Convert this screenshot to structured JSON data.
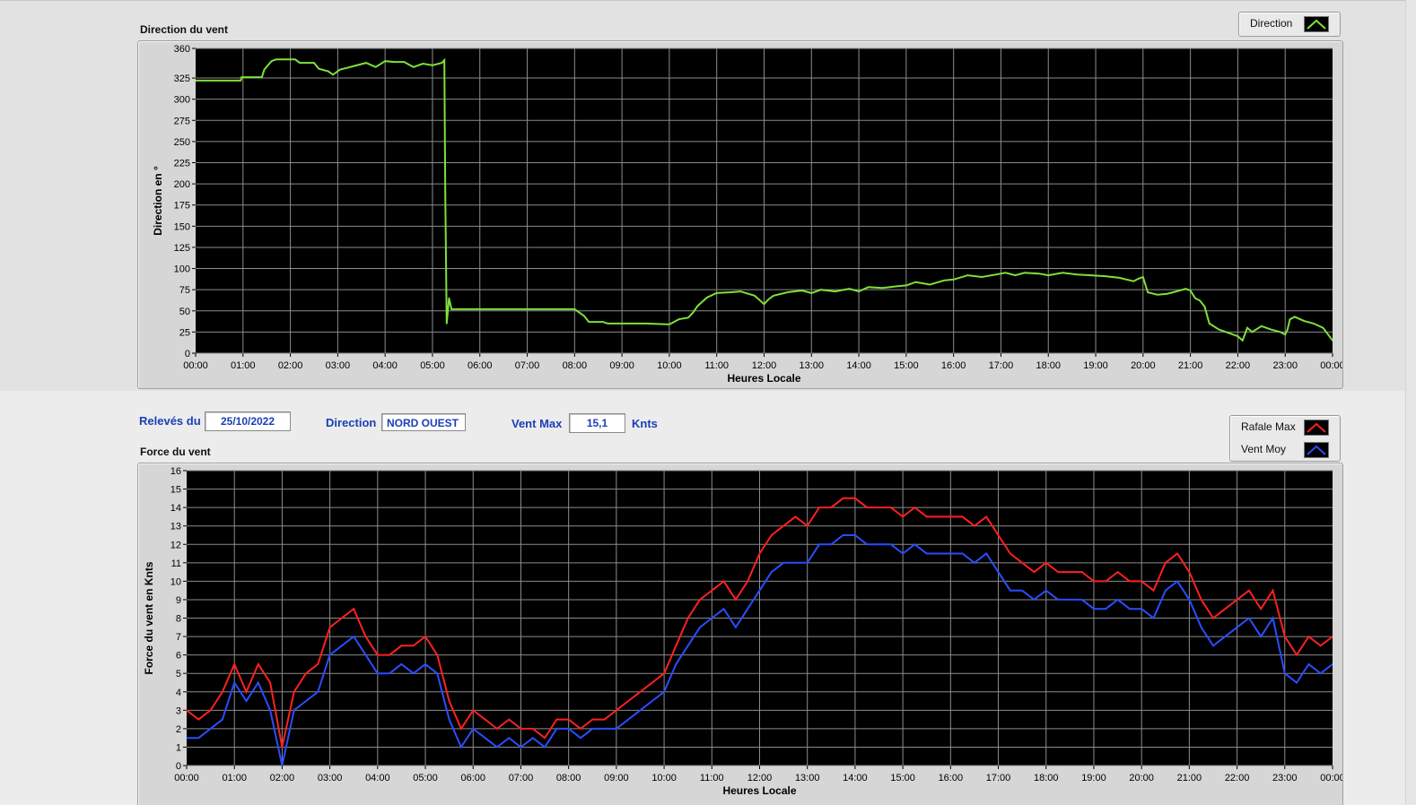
{
  "direction_section": {
    "title": "Direction du vent",
    "legend": {
      "label": "Direction",
      "color": "#7fe03a"
    }
  },
  "info_bar": {
    "date_label": "Relevés du",
    "date_value": "25/10/2022",
    "direction_label": "Direction",
    "direction_value": "NORD OUEST",
    "vent_max_label": "Vent Max",
    "vent_max_value": "15,1",
    "vent_max_unit": "Knts"
  },
  "force_section": {
    "title": "Force du vent",
    "legend": [
      {
        "label": "Rafale Max",
        "color": "#ff2020"
      },
      {
        "label": "Vent Moy",
        "color": "#2a4dff"
      }
    ]
  },
  "chart_data": [
    {
      "type": "line",
      "ylabel": "Direction en °",
      "xlabel": "Heures Locale",
      "ylim": [
        0,
        360
      ],
      "xlim": [
        0,
        24
      ],
      "yticks": [
        0,
        25,
        50,
        75,
        100,
        125,
        150,
        175,
        200,
        225,
        250,
        275,
        300,
        325,
        360
      ],
      "xtick_labels": [
        "00:00",
        "01:00",
        "02:00",
        "03:00",
        "04:00",
        "05:00",
        "06:00",
        "07:00",
        "08:00",
        "09:00",
        "10:00",
        "11:00",
        "12:00",
        "13:00",
        "14:00",
        "15:00",
        "16:00",
        "17:00",
        "18:00",
        "19:00",
        "20:00",
        "21:00",
        "22:00",
        "23:00",
        "00:00"
      ],
      "grid": true,
      "background": "#000000",
      "series": [
        {
          "name": "Direction",
          "color": "#7fe03a",
          "x": [
            0,
            0.95,
            0.97,
            1.4,
            1.45,
            1.6,
            1.7,
            2.1,
            2.2,
            2.5,
            2.6,
            2.8,
            2.9,
            3.05,
            3.2,
            3.4,
            3.6,
            3.8,
            4.0,
            4.2,
            4.4,
            4.6,
            4.8,
            5.0,
            5.2,
            5.25,
            5.27,
            5.3,
            5.35,
            5.4,
            5.6,
            6.0,
            7.0,
            8.0,
            8.2,
            8.3,
            8.6,
            8.7,
            9.0,
            9.5,
            10.0,
            10.2,
            10.4,
            10.5,
            10.6,
            10.8,
            11.0,
            11.3,
            11.5,
            11.8,
            12.0,
            12.1,
            12.2,
            12.5,
            12.8,
            13.0,
            13.2,
            13.5,
            13.8,
            14.0,
            14.2,
            14.5,
            14.8,
            15.0,
            15.2,
            15.5,
            15.8,
            16.0,
            16.3,
            16.6,
            16.9,
            17.1,
            17.3,
            17.5,
            17.8,
            18.0,
            18.3,
            18.6,
            18.9,
            19.2,
            19.5,
            19.8,
            19.9,
            20.0,
            20.1,
            20.3,
            20.5,
            20.7,
            20.9,
            21.0,
            21.1,
            21.2,
            21.3,
            21.4,
            21.6,
            21.8,
            22.0,
            22.1,
            22.2,
            22.3,
            22.5,
            22.7,
            22.9,
            23.0,
            23.05,
            23.1,
            23.2,
            23.4,
            23.6,
            23.8,
            24.0
          ],
          "y": [
            322,
            322,
            326,
            326,
            335,
            345,
            347,
            347,
            343,
            343,
            336,
            333,
            329,
            335,
            337,
            340,
            343,
            338,
            345,
            344,
            344,
            338,
            342,
            340,
            343,
            346,
            190,
            35,
            65,
            52,
            52,
            52,
            52,
            52,
            44,
            37,
            37,
            35,
            35,
            35,
            34,
            40,
            42,
            48,
            56,
            66,
            71,
            72,
            73,
            68,
            58,
            64,
            68,
            72,
            74,
            71,
            75,
            73,
            76,
            73,
            78,
            77,
            79,
            80,
            84,
            81,
            86,
            87,
            92,
            90,
            93,
            95,
            92,
            95,
            94,
            92,
            95,
            93,
            92,
            91,
            89,
            85,
            88,
            90,
            72,
            69,
            70,
            73,
            76,
            74,
            65,
            62,
            55,
            35,
            28,
            24,
            20,
            15,
            30,
            25,
            32,
            28,
            25,
            22,
            28,
            40,
            43,
            38,
            35,
            30,
            15
          ]
        }
      ]
    },
    {
      "type": "line",
      "ylabel": "Force du vent en Knts",
      "xlabel": "Heures Locale",
      "ylim": [
        0,
        16
      ],
      "xlim": [
        0,
        24
      ],
      "yticks": [
        0,
        1,
        2,
        3,
        4,
        5,
        6,
        7,
        8,
        9,
        10,
        11,
        12,
        13,
        14,
        15,
        16
      ],
      "xtick_labels": [
        "00:00",
        "01:00",
        "02:00",
        "03:00",
        "04:00",
        "05:00",
        "06:00",
        "07:00",
        "08:00",
        "09:00",
        "10:00",
        "11:00",
        "12:00",
        "13:00",
        "14:00",
        "15:00",
        "16:00",
        "17:00",
        "18:00",
        "19:00",
        "20:00",
        "21:00",
        "22:00",
        "23:00",
        "00:00"
      ],
      "grid": true,
      "background": "#000000",
      "series": [
        {
          "name": "Rafale Max",
          "color": "#ff2020",
          "x": [
            0,
            0.25,
            0.5,
            0.75,
            1.0,
            1.25,
            1.5,
            1.75,
            2.0,
            2.25,
            2.5,
            2.75,
            3.0,
            3.25,
            3.5,
            3.75,
            4.0,
            4.25,
            4.5,
            4.75,
            5.0,
            5.25,
            5.5,
            5.75,
            6.0,
            6.25,
            6.5,
            6.75,
            7.0,
            7.25,
            7.5,
            7.75,
            8.0,
            8.25,
            8.5,
            8.75,
            9.0,
            9.25,
            9.5,
            9.75,
            10.0,
            10.25,
            10.5,
            10.75,
            11.0,
            11.25,
            11.5,
            11.75,
            12.0,
            12.25,
            12.5,
            12.75,
            13.0,
            13.25,
            13.5,
            13.75,
            14.0,
            14.25,
            14.5,
            14.75,
            15.0,
            15.25,
            15.5,
            15.75,
            16.0,
            16.25,
            16.5,
            16.75,
            17.0,
            17.25,
            17.5,
            17.75,
            18.0,
            18.25,
            18.5,
            18.75,
            19.0,
            19.25,
            19.5,
            19.75,
            20.0,
            20.25,
            20.5,
            20.75,
            21.0,
            21.25,
            21.5,
            21.75,
            22.0,
            22.25,
            22.5,
            22.75,
            23.0,
            23.25,
            23.5,
            23.75,
            24.0
          ],
          "y": [
            3,
            2.5,
            3,
            4,
            5.5,
            4,
            5.5,
            4.5,
            1,
            4,
            5,
            5.5,
            7.5,
            8,
            8.5,
            7,
            6,
            6,
            6.5,
            6.5,
            7,
            6,
            3.5,
            2,
            3,
            2.5,
            2,
            2.5,
            2,
            2,
            1.5,
            2.5,
            2.5,
            2,
            2.5,
            2.5,
            3,
            3.5,
            4,
            4.5,
            5,
            6.5,
            8,
            9,
            9.5,
            10,
            9,
            10,
            11.5,
            12.5,
            13,
            13.5,
            13,
            14,
            14,
            14.5,
            14.5,
            14,
            14,
            14,
            13.5,
            14,
            13.5,
            13.5,
            13.5,
            13.5,
            13,
            13.5,
            12.5,
            11.5,
            11,
            10.5,
            11,
            10.5,
            10.5,
            10.5,
            10,
            10,
            10.5,
            10,
            10,
            9.5,
            11,
            11.5,
            10.5,
            9,
            8,
            8.5,
            9,
            9.5,
            8.5,
            9.5,
            7,
            6,
            7,
            6.5,
            7
          ]
        },
        {
          "name": "Vent Moy",
          "color": "#2a4dff",
          "x": [
            0,
            0.25,
            0.5,
            0.75,
            1.0,
            1.25,
            1.5,
            1.75,
            2.0,
            2.25,
            2.5,
            2.75,
            3.0,
            3.25,
            3.5,
            3.75,
            4.0,
            4.25,
            4.5,
            4.75,
            5.0,
            5.25,
            5.5,
            5.75,
            6.0,
            6.25,
            6.5,
            6.75,
            7.0,
            7.25,
            7.5,
            7.75,
            8.0,
            8.25,
            8.5,
            8.75,
            9.0,
            9.25,
            9.5,
            9.75,
            10.0,
            10.25,
            10.5,
            10.75,
            11.0,
            11.25,
            11.5,
            11.75,
            12.0,
            12.25,
            12.5,
            12.75,
            13.0,
            13.25,
            13.5,
            13.75,
            14.0,
            14.25,
            14.5,
            14.75,
            15.0,
            15.25,
            15.5,
            15.75,
            16.0,
            16.25,
            16.5,
            16.75,
            17.0,
            17.25,
            17.5,
            17.75,
            18.0,
            18.25,
            18.5,
            18.75,
            19.0,
            19.25,
            19.5,
            19.75,
            20.0,
            20.25,
            20.5,
            20.75,
            21.0,
            21.25,
            21.5,
            21.75,
            22.0,
            22.25,
            22.5,
            22.75,
            23.0,
            23.25,
            23.5,
            23.75,
            24.0
          ],
          "y": [
            1.5,
            1.5,
            2,
            2.5,
            4.5,
            3.5,
            4.5,
            3,
            0,
            3,
            3.5,
            4,
            6,
            6.5,
            7,
            6,
            5,
            5,
            5.5,
            5,
            5.5,
            5,
            2.5,
            1,
            2,
            1.5,
            1,
            1.5,
            1,
            1.5,
            1,
            2,
            2,
            1.5,
            2,
            2,
            2,
            2.5,
            3,
            3.5,
            4,
            5.5,
            6.5,
            7.5,
            8,
            8.5,
            7.5,
            8.5,
            9.5,
            10.5,
            11,
            11,
            11,
            12,
            12,
            12.5,
            12.5,
            12,
            12,
            12,
            11.5,
            12,
            11.5,
            11.5,
            11.5,
            11.5,
            11,
            11.5,
            10.5,
            9.5,
            9.5,
            9,
            9.5,
            9,
            9,
            9,
            8.5,
            8.5,
            9,
            8.5,
            8.5,
            8,
            9.5,
            10,
            9,
            7.5,
            6.5,
            7,
            7.5,
            8,
            7,
            8,
            5,
            4.5,
            5.5,
            5,
            5.5
          ]
        }
      ]
    }
  ]
}
